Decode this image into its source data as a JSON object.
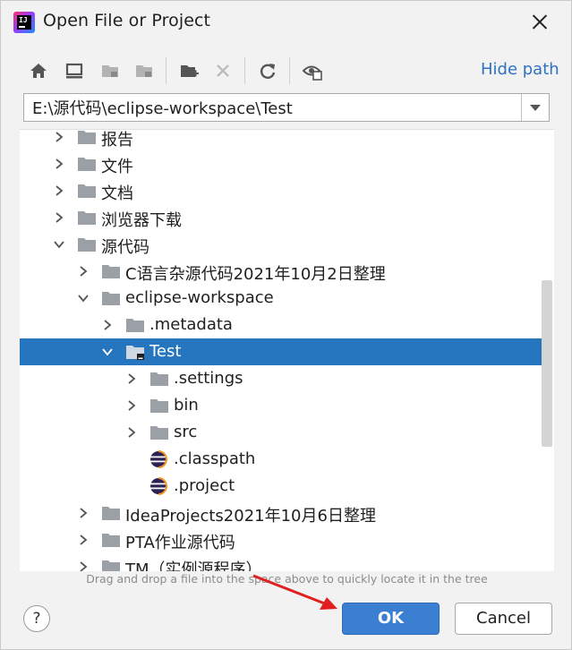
{
  "window": {
    "title": "Open File or Project"
  },
  "toolbar": {
    "hide_path_label": "Hide path"
  },
  "path": {
    "value": "E:\\源代码\\eclipse-workspace\\Test"
  },
  "tree": {
    "items": [
      {
        "label": "报告"
      },
      {
        "label": "文件"
      },
      {
        "label": "文档"
      },
      {
        "label": "浏览器下载"
      },
      {
        "label": "源代码"
      },
      {
        "label": "C语言杂源代码2021年10月2日整理"
      },
      {
        "label": "eclipse-workspace"
      },
      {
        "label": ".metadata"
      },
      {
        "label": "Test"
      },
      {
        "label": ".settings"
      },
      {
        "label": "bin"
      },
      {
        "label": "src"
      },
      {
        "label": ".classpath"
      },
      {
        "label": ".project"
      },
      {
        "label": "IdeaProjects2021年10月6日整理"
      },
      {
        "label": "PTA作业源代码"
      },
      {
        "label": "TM（实例源程序）"
      }
    ]
  },
  "hint": "Drag and drop a file into the space above to quickly locate it in the tree",
  "buttons": {
    "help": "?",
    "ok": "OK",
    "cancel": "Cancel"
  },
  "colors": {
    "selection": "#2675bf",
    "link": "#2f72c4",
    "ok_button": "#3a7fd1",
    "arrow": "#e02020"
  }
}
